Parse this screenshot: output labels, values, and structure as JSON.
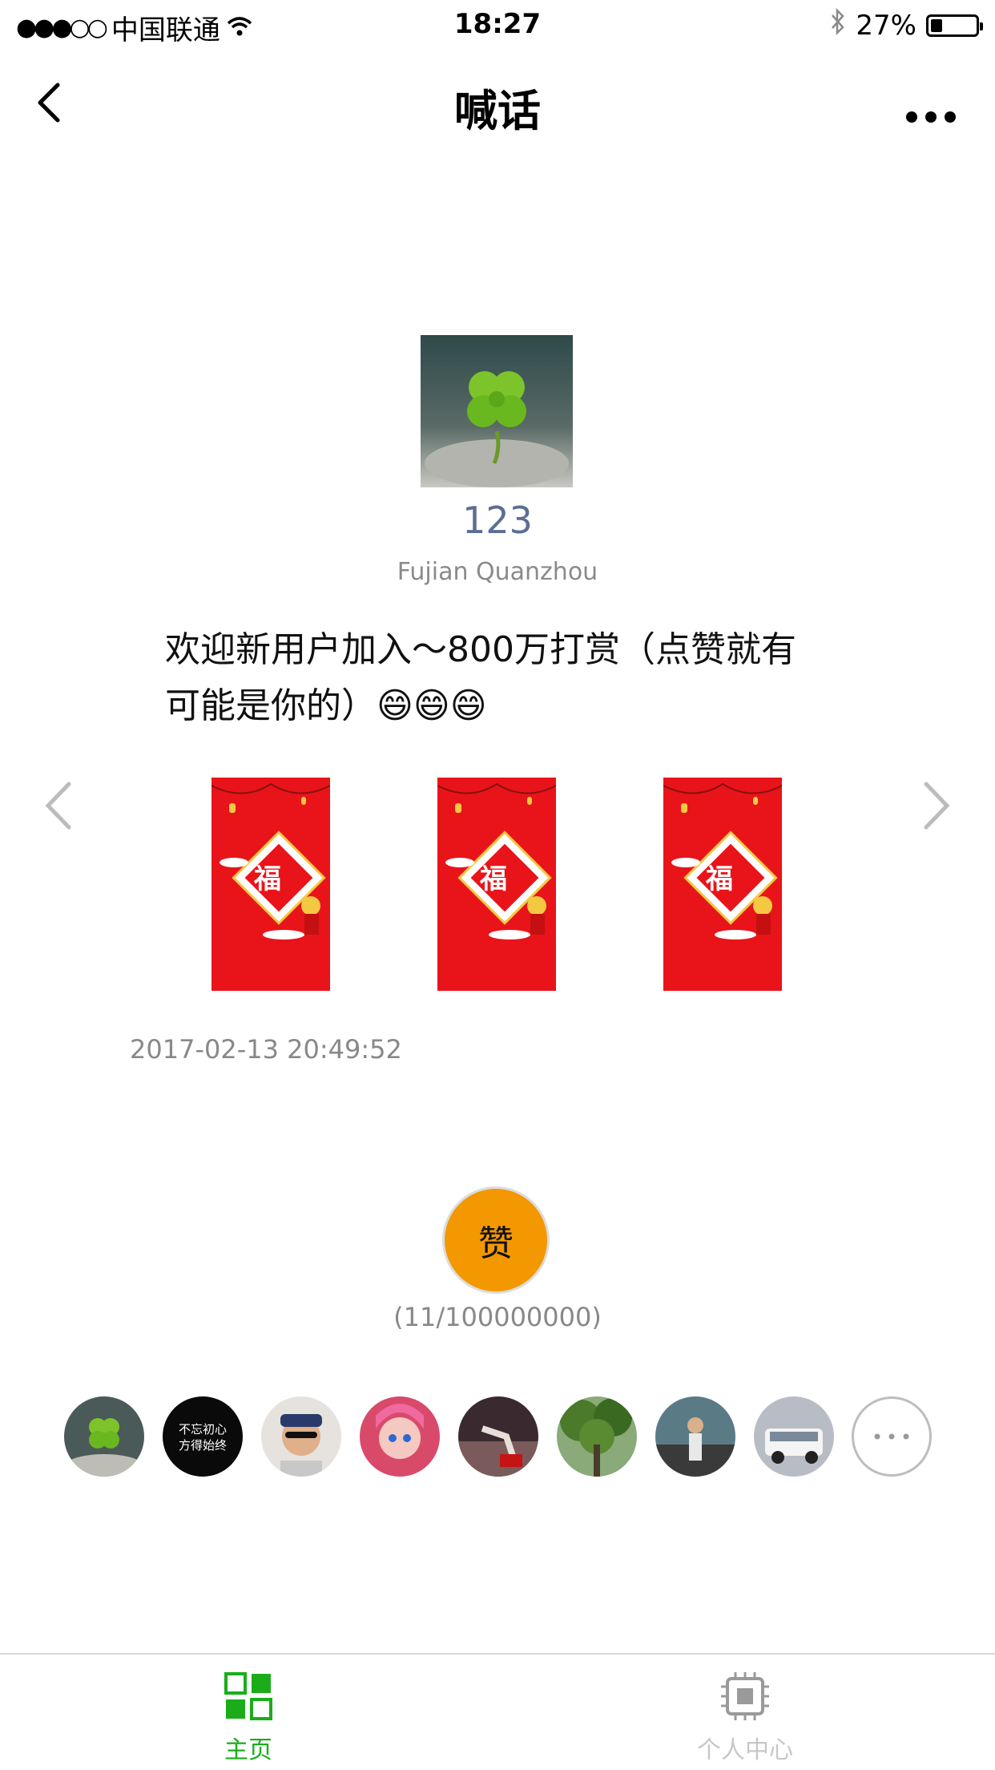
{
  "status_bar": {
    "signal": "●●●○○",
    "carrier": "中国联通",
    "time": "18:27",
    "battery": "27%",
    "battery_level": 0.27
  },
  "nav": {
    "title": "喊话"
  },
  "post": {
    "username": "123",
    "location": "Fujian Quanzhou",
    "message": "欢迎新用户加入～800万打赏（点赞就有可能是你的）😄😄😄",
    "timestamp": "2017-02-13 20:49:52"
  },
  "like": {
    "label": "赞",
    "count": "(11/100000000)"
  },
  "likers": {
    "avatar_2_text_line1": "不忘初心",
    "avatar_2_text_line2": "方得始终"
  },
  "tabbar": {
    "home_label": "主页",
    "me_label": "个人中心",
    "active_color": "#1aad19",
    "inactive_color": "#c8c8c8"
  },
  "colors": {
    "username": "#5a6e96",
    "like_button": "#f39800",
    "red_envelope": "#e8141a"
  }
}
